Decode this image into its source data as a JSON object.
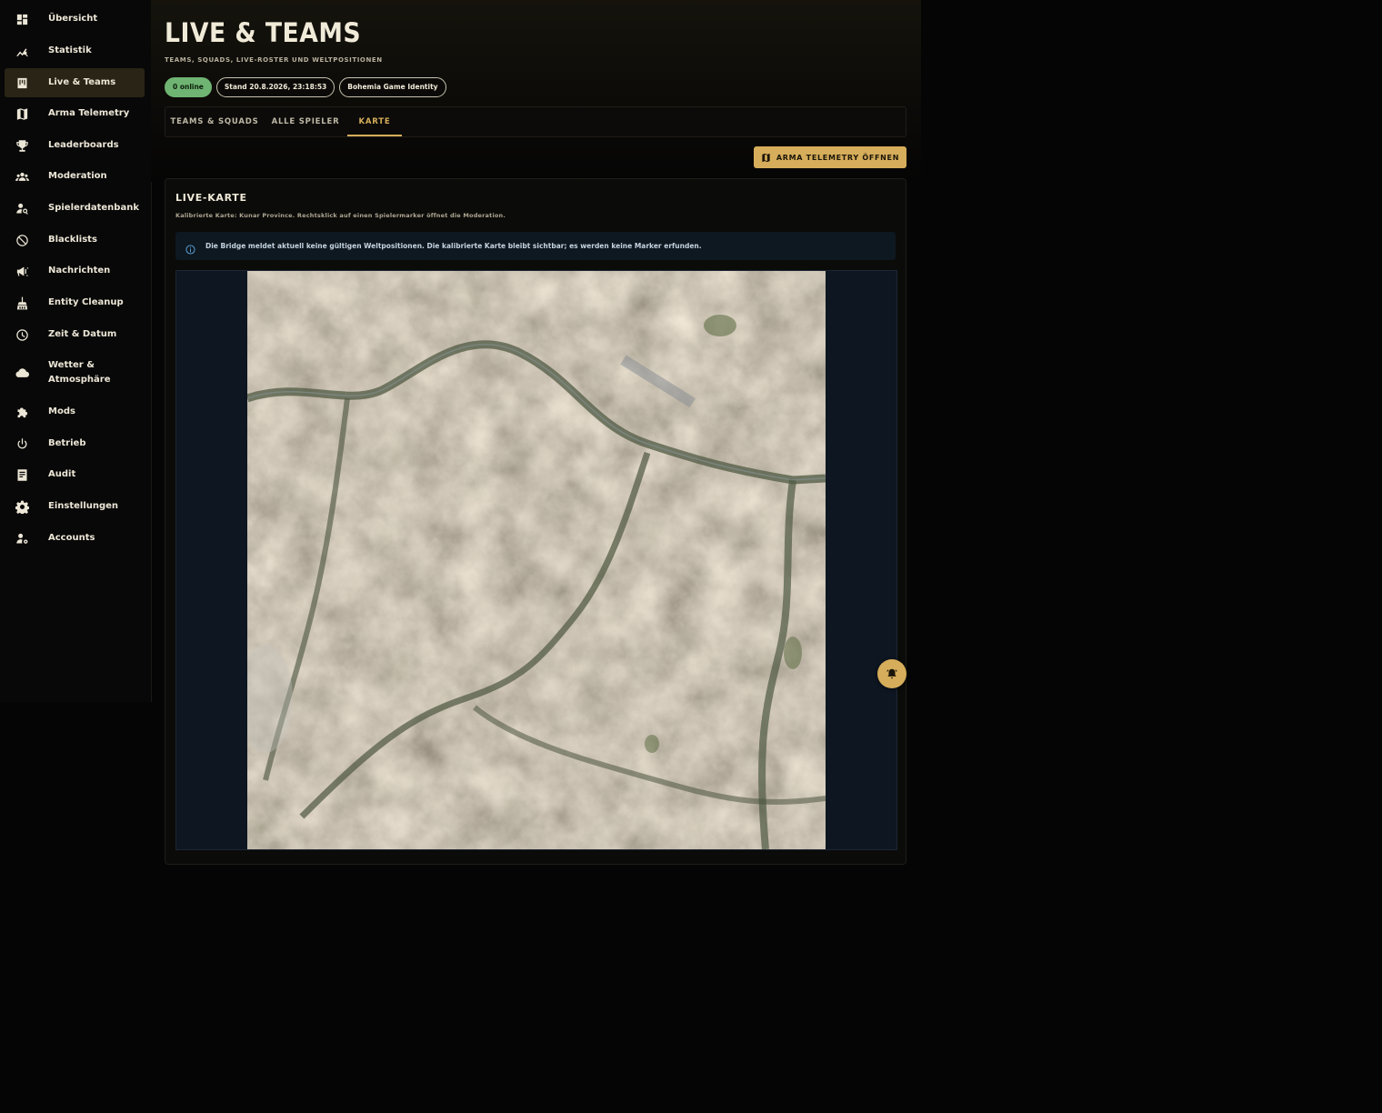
{
  "sidebar": {
    "items": [
      {
        "label": "Übersicht",
        "icon": "dashboard-icon"
      },
      {
        "label": "Statistik",
        "icon": "chart-icon"
      },
      {
        "label": "Live & Teams",
        "icon": "teams-icon",
        "active": true
      },
      {
        "label": "Arma Telemetry",
        "icon": "map-icon"
      },
      {
        "label": "Leaderboards",
        "icon": "trophy-icon"
      },
      {
        "label": "Moderation",
        "icon": "group-icon"
      },
      {
        "label": "Spielerdatenbank",
        "icon": "user-search-icon"
      },
      {
        "label": "Blacklists",
        "icon": "block-icon"
      },
      {
        "label": "Nachrichten",
        "icon": "megaphone-icon"
      },
      {
        "label": "Entity Cleanup",
        "icon": "broom-icon"
      },
      {
        "label": "Zeit & Datum",
        "icon": "clock-icon"
      },
      {
        "label": "Wetter & Atmosphäre",
        "icon": "cloud-icon"
      },
      {
        "label": "Mods",
        "icon": "puzzle-icon"
      },
      {
        "label": "Betrieb",
        "icon": "power-icon"
      },
      {
        "label": "Audit",
        "icon": "receipt-icon"
      },
      {
        "label": "Einstellungen",
        "icon": "gear-icon"
      },
      {
        "label": "Accounts",
        "icon": "user-gear-icon"
      }
    ]
  },
  "header": {
    "title": "LIVE & TEAMS",
    "subtitle": "TEAMS, SQUADS, LIVE-ROSTER UND WELTPOSITIONEN",
    "badges": {
      "online": "0 online",
      "stand": "Stand 20.8.2026, 23:18:53",
      "identity": "Bohemia Game Identity"
    }
  },
  "tabs": [
    {
      "label": "TEAMS & SQUADS",
      "active": false
    },
    {
      "label": "ALLE SPIELER",
      "active": false
    },
    {
      "label": "KARTE",
      "active": true
    }
  ],
  "actions": {
    "telemetry_label": "ARMA TELEMETRY ÖFFNEN"
  },
  "card": {
    "title": "LIVE-KARTE",
    "subtitle": "Kalibrierte Karte: Kunar Province. Rechtsklick auf einen Spielermarker öffnet die Moderation.",
    "info": "Die Bridge meldet aktuell keine gültigen Weltpositionen. Die kalibrierte Karte bleibt sichtbar; es werden keine Marker erfunden."
  },
  "colors": {
    "accent": "#d6ad5a",
    "online": "#6fb472",
    "background": "#050505",
    "info_bg": "#0e1820"
  }
}
